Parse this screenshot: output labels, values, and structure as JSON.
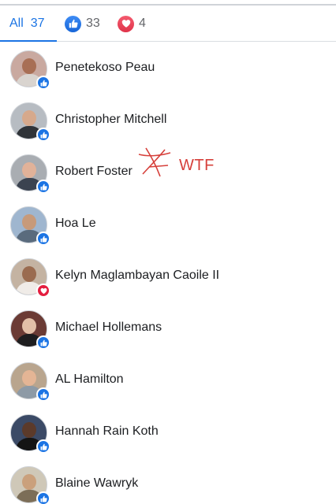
{
  "tabs": {
    "all": {
      "label": "All",
      "count": "37"
    },
    "like": {
      "icon": "thumbs-up-icon",
      "count": "33",
      "color": "#1b74e4"
    },
    "love": {
      "icon": "heart-icon",
      "count": "4",
      "color": "#e41e3f"
    }
  },
  "reactors": [
    {
      "name": "Penetekoso Peau",
      "reaction": "like"
    },
    {
      "name": "Christopher Mitchell",
      "reaction": "like"
    },
    {
      "name": "Robert Foster",
      "reaction": "like"
    },
    {
      "name": "Hoa Le",
      "reaction": "like"
    },
    {
      "name": "Kelyn Maglambayan Caoile II",
      "reaction": "love"
    },
    {
      "name": "Michael Hollemans",
      "reaction": "like"
    },
    {
      "name": "AL Hamilton",
      "reaction": "like"
    },
    {
      "name": "Hannah Rain Koth",
      "reaction": "like"
    },
    {
      "name": "Blaine Wawryk",
      "reaction": "like"
    }
  ],
  "annotation": {
    "text": "WTF",
    "color": "#d6403b"
  }
}
